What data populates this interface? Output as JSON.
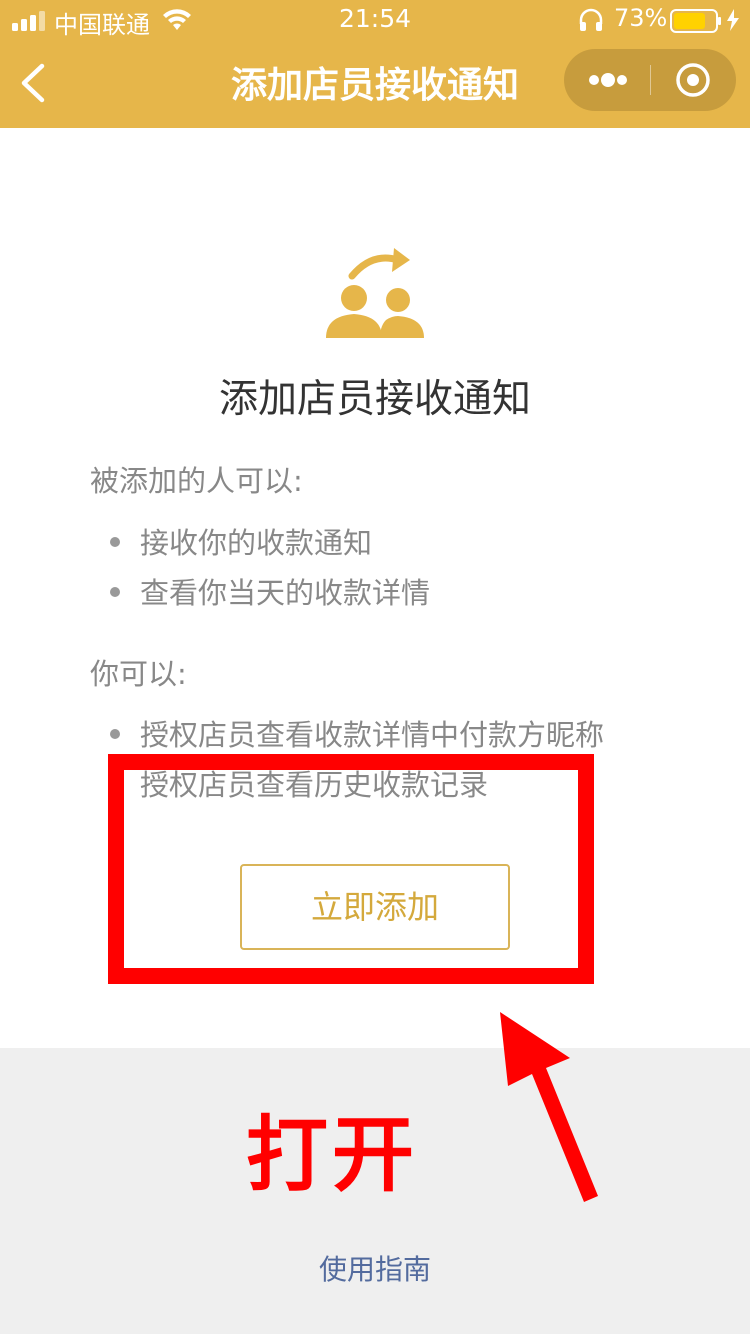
{
  "status_bar": {
    "carrier": "中国联通",
    "time": "21:54",
    "battery_percent": "73%"
  },
  "nav": {
    "title": "添加店员接收通知",
    "back_icon": "chevron-left-icon",
    "more_icon": "more-dots-icon",
    "close_icon": "target-circle-icon"
  },
  "main": {
    "title": "添加店员接收通知",
    "section1_label": "被添加的人可以:",
    "section1_items": [
      "接收你的收款通知",
      "查看你当天的收款详情"
    ],
    "section2_label": "你可以:",
    "section2_items": [
      "授权店员查看收款详情中付款方昵称",
      "授权店员查看历史收款记录"
    ],
    "add_button_label": "立即添加"
  },
  "footer": {
    "guide_link": "使用指南"
  },
  "annotation": {
    "text": "打开",
    "color": "#ff0000"
  },
  "colors": {
    "brand": "#e6b64a",
    "button_text": "#d4a93c",
    "link": "#536b9e"
  }
}
